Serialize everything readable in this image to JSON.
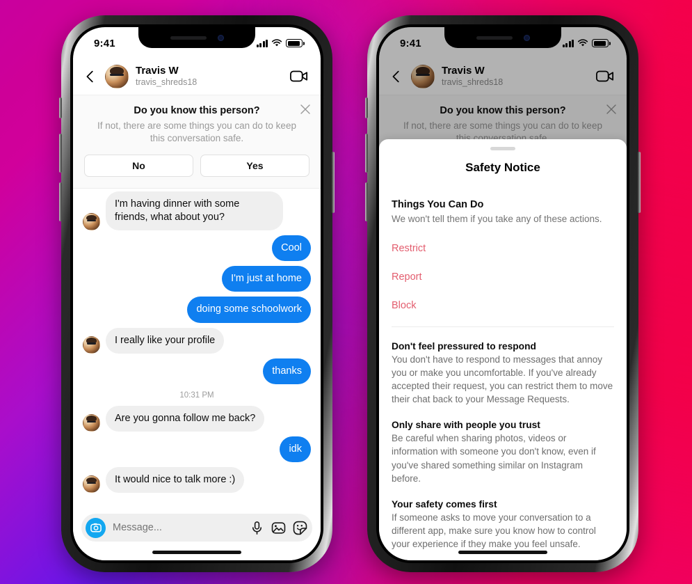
{
  "background": {
    "gradient_colors": [
      "#D4009C",
      "#7A15DE",
      "#1414F0",
      "#F5004E",
      "#E60090"
    ]
  },
  "theme": {
    "bubble_out": "#0f7ff0",
    "bubble_in": "#efefef",
    "action_red": "#E35D6E",
    "camera_blue": "#13a7f0"
  },
  "status_bar": {
    "time": "9:41",
    "cellular_icon": "signal-bars-icon",
    "wifi_icon": "wifi-icon",
    "battery_icon": "battery-icon"
  },
  "chat_header": {
    "back_icon": "back-chevron-icon",
    "avatar_icon": "avatar",
    "name": "Travis W",
    "handle": "travis_shreds18",
    "video_icon": "video-camera-icon"
  },
  "know_banner": {
    "title": "Do you know this person?",
    "subtitle": "If not, there are some things you can do to keep this conversation safe.",
    "close_icon": "close-x-icon",
    "buttons": [
      {
        "label": "No"
      },
      {
        "label": "Yes"
      }
    ]
  },
  "conversation": {
    "messages": [
      {
        "dir": "in",
        "text": "I'm having dinner with some friends, what about you?"
      },
      {
        "dir": "out",
        "text": "Cool"
      },
      {
        "dir": "out",
        "text": "I'm just at home"
      },
      {
        "dir": "out",
        "text": "doing some schoolwork"
      },
      {
        "dir": "in",
        "text": "I really like your profile"
      },
      {
        "dir": "out",
        "text": "thanks"
      }
    ],
    "timestamp": "10:31 PM",
    "messages_after": [
      {
        "dir": "in",
        "text": "Are you gonna follow me back?"
      },
      {
        "dir": "out",
        "text": "idk"
      },
      {
        "dir": "in",
        "text": "It would nice to talk more :)"
      }
    ]
  },
  "composer": {
    "camera_icon": "camera-icon",
    "placeholder": "Message...",
    "mic_icon": "microphone-icon",
    "gallery_icon": "photo-gallery-icon",
    "sticker_icon": "sticker-icon"
  },
  "safety_sheet": {
    "grabber": "drag-handle",
    "title": "Safety Notice",
    "section_heading": "Things You Can Do",
    "section_subtext": "We won't tell them if you take any of these actions.",
    "actions": [
      {
        "label": "Restrict"
      },
      {
        "label": "Report"
      },
      {
        "label": "Block"
      }
    ],
    "tips": [
      {
        "heading": "Don't feel pressured to respond",
        "body": "You don't have to respond to messages that annoy you or make you uncomfortable. If you've already accepted their request, you can restrict them to move their chat back to your Message Requests."
      },
      {
        "heading": "Only share with people you trust",
        "body": "Be careful when sharing photos, videos or information with someone you don't know, even if you've shared something similar on Instagram before."
      },
      {
        "heading": "Your safety comes first",
        "body": "If someone asks to move your conversation to a different app, make sure you know how to control your experience if they make you feel unsafe."
      }
    ]
  }
}
